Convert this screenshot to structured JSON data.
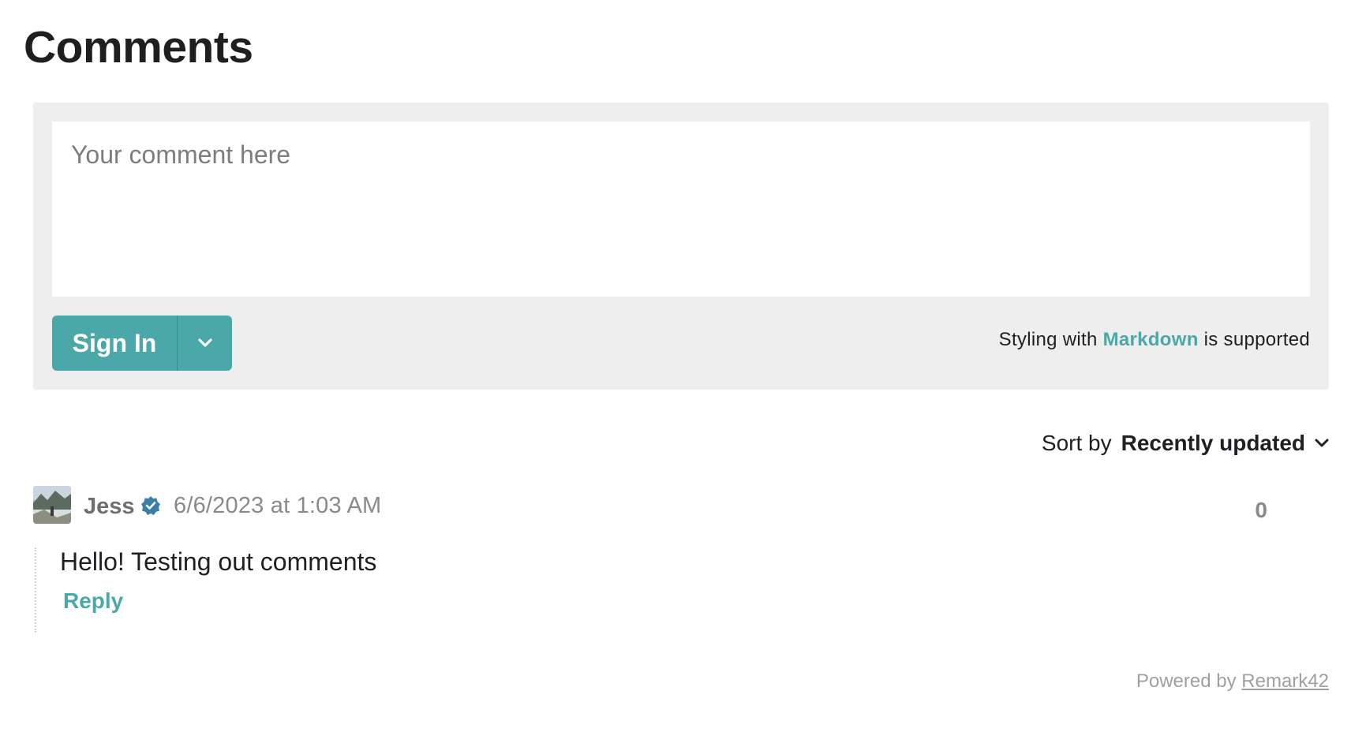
{
  "page": {
    "title": "Comments"
  },
  "form": {
    "placeholder": "Your comment here",
    "signin_label": "Sign In",
    "markdown_prefix": "Styling with",
    "markdown_link": "Markdown",
    "markdown_suffix": "is supported"
  },
  "sort": {
    "label": "Sort by",
    "value": "Recently updated"
  },
  "comments": [
    {
      "author": "Jess",
      "verified": true,
      "timestamp": "6/6/2023 at 1:03 AM",
      "score": "0",
      "text": "Hello! Testing out comments",
      "reply_label": "Reply"
    }
  ],
  "footer": {
    "prefix": "Powered by",
    "link": "Remark42"
  },
  "colors": {
    "accent": "#4aa8a8",
    "verified": "#3a7fa8",
    "form_bg": "#eeeeee"
  },
  "icons": {
    "dropdown": "chevron-down-icon",
    "verified": "verified-badge-icon"
  }
}
